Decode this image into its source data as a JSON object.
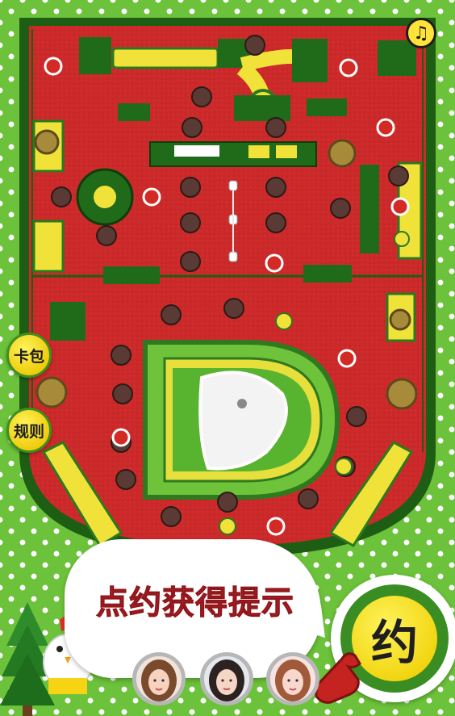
{
  "game": {
    "side_buttons": {
      "card_label": "卡包",
      "rules_label": "规则"
    },
    "hint": {
      "text": "点约获得提示"
    },
    "date_button": {
      "label": "约"
    },
    "music_icon": "music-note-icon",
    "avatars": [
      {
        "name": "girl-avatar-1",
        "hair": "#7a4a2d"
      },
      {
        "name": "girl-avatar-2",
        "hair": "#2c2220"
      },
      {
        "name": "girl-avatar-3",
        "hair": "#a05a3a"
      }
    ],
    "colors": {
      "floor_red": "#cc2a2a",
      "board_green": "#2f7a1f",
      "accent_yellow": "#f2d413",
      "hint_red": "#b3252b",
      "dots_bg": "#6cc23a"
    }
  }
}
